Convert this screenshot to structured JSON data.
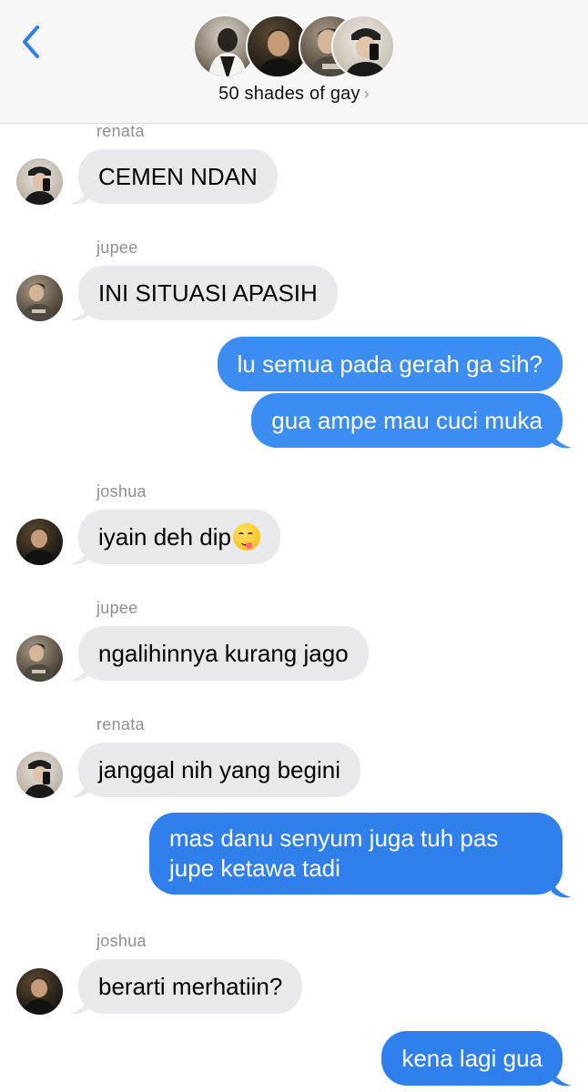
{
  "header": {
    "back_icon": "chevron-left-icon",
    "group_name": "50 shades of gay",
    "chevron": "›",
    "accent_color": "#2f80ed"
  },
  "messages": [
    {
      "type": "incoming",
      "sender": "renata",
      "text": "CEMEN NDAN"
    },
    {
      "type": "incoming",
      "sender": "jupee",
      "text": "INI SITUASI APASIH"
    },
    {
      "type": "outgoing",
      "text": "lu semua pada gerah ga sih?"
    },
    {
      "type": "outgoing",
      "text": "gua ampe mau cuci muka"
    },
    {
      "type": "incoming",
      "sender": "joshua",
      "text": "iyain deh dip",
      "emoji": "face-savoring-food-emoji"
    },
    {
      "type": "incoming",
      "sender": "jupee",
      "text": "ngalihinnya kurang jago"
    },
    {
      "type": "incoming",
      "sender": "renata",
      "text": "janggal nih yang begini"
    },
    {
      "type": "outgoing",
      "text": "mas danu senyum juga tuh pas jupe ketawa tadi"
    },
    {
      "type": "incoming",
      "sender": "joshua",
      "text": "berarti merhatiin?"
    },
    {
      "type": "outgoing",
      "text": "kena lagi gua"
    }
  ]
}
